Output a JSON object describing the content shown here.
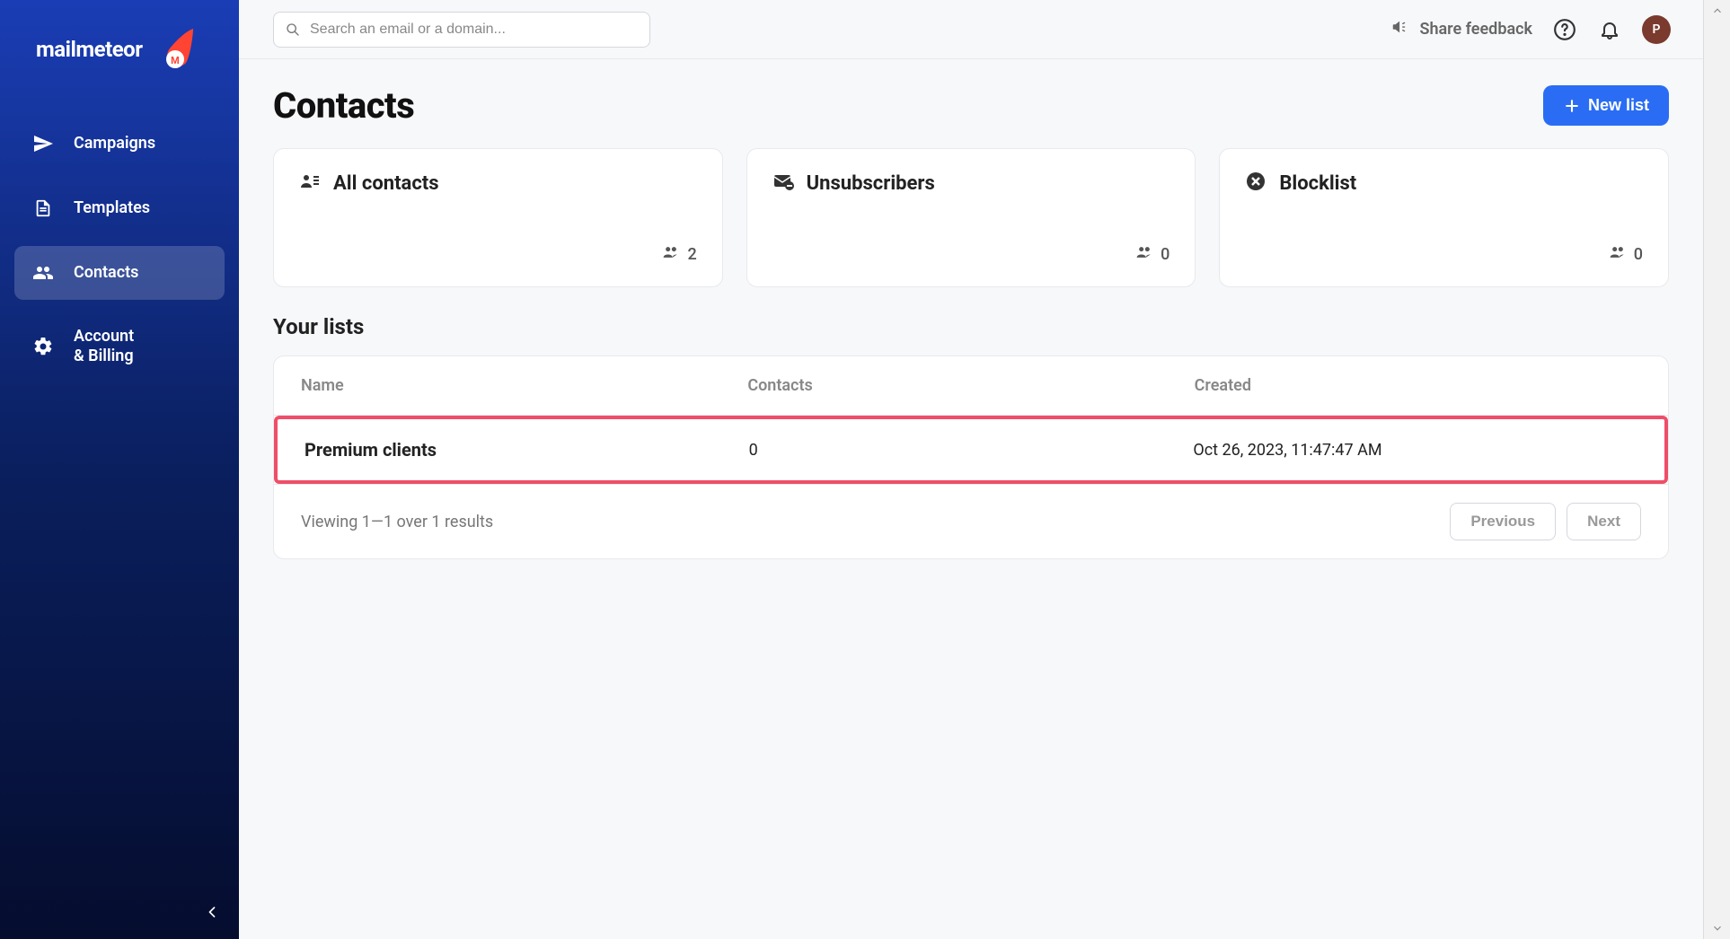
{
  "brand": {
    "name": "mailmeteor"
  },
  "sidebar": {
    "items": [
      {
        "label": "Campaigns"
      },
      {
        "label": "Templates"
      },
      {
        "label": "Contacts"
      },
      {
        "label": "Account\n& Billing"
      }
    ]
  },
  "topbar": {
    "search_placeholder": "Search an email or a domain...",
    "feedback_label": "Share feedback",
    "avatar_initial": "P"
  },
  "page": {
    "title": "Contacts",
    "new_list_label": "New list"
  },
  "cards": [
    {
      "title": "All contacts",
      "count": "2"
    },
    {
      "title": "Unsubscribers",
      "count": "0"
    },
    {
      "title": "Blocklist",
      "count": "0"
    }
  ],
  "section_title": "Your lists",
  "table": {
    "headers": {
      "name": "Name",
      "contacts": "Contacts",
      "created": "Created"
    },
    "rows": [
      {
        "name": "Premium clients",
        "contacts": "0",
        "created": "Oct 26, 2023, 11:47:47 AM"
      }
    ],
    "footer": {
      "result_text": "Viewing 1—1 over 1 results",
      "prev_label": "Previous",
      "next_label": "Next"
    }
  }
}
